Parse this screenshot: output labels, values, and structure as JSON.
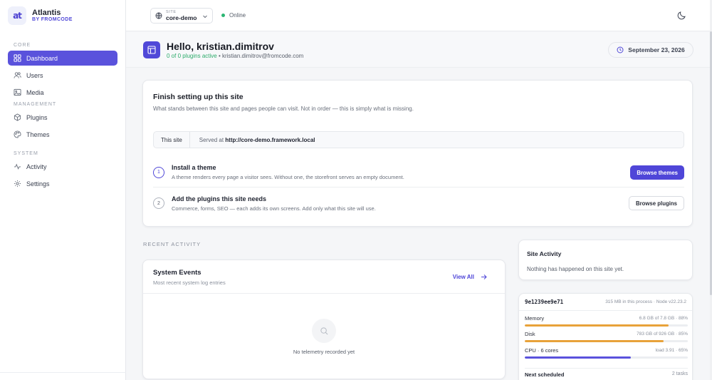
{
  "brand": {
    "name": "Atlantis",
    "sub": "BY FROMCODE",
    "logo_text": "at"
  },
  "sidebar": {
    "sections": [
      {
        "label": "CORE"
      },
      {
        "label": "MANAGEMENT"
      },
      {
        "label": "SYSTEM"
      }
    ],
    "items": [
      {
        "label": "Dashboard",
        "icon": "dashboard-icon",
        "active": true
      },
      {
        "label": "Users",
        "icon": "users-icon"
      },
      {
        "label": "Media",
        "icon": "image-icon"
      },
      {
        "label": "Plugins",
        "icon": "cube-icon"
      },
      {
        "label": "Themes",
        "icon": "palette-icon"
      },
      {
        "label": "Activity",
        "icon": "activity-icon"
      },
      {
        "label": "Settings",
        "icon": "gear-icon"
      }
    ]
  },
  "topbar": {
    "site_label": "SITE",
    "site_value": "core-demo",
    "status": "Online"
  },
  "header": {
    "greeting": "Hello, kristian.dimitrov",
    "plugins_active": "0 of 0 plugins active",
    "email": "kristian.dimitrov@fromcode.com",
    "date": "September 23, 2026"
  },
  "setup": {
    "title": "Finish setting up this site",
    "description": "What stands between this site and pages people can visit. Not in order — this is simply what is missing.",
    "site_label": "This site",
    "served_prefix": "Served at ",
    "served_url": "http://core-demo.framework.local",
    "steps": [
      {
        "num": "1",
        "title": "Install a theme",
        "text": "A theme renders every page a visitor sees. Without one, the storefront serves an empty document.",
        "button": "Browse themes"
      },
      {
        "num": "2",
        "title": "Add the plugins this site needs",
        "text": "Commerce, forms, SEO — each adds its own screens. Add only what this site will use.",
        "button": "Browse plugins"
      }
    ]
  },
  "recent": {
    "label": "RECENT ACTIVITY",
    "events_title": "System Events",
    "events_sub": "Most recent system log entries",
    "view_all": "View All",
    "empty": "No telemetry recorded yet"
  },
  "site_activity": {
    "title": "Site Activity",
    "text": "Nothing has happened on this site yet."
  },
  "stats": {
    "hash": "9e1239ee9e71",
    "meta": "315 MB in this process · Node v22.23.2",
    "rows": [
      {
        "name": "Memory",
        "value": "6.8 GB of 7.8 GB · 88%",
        "pct": 88,
        "color": "#e8a23a"
      },
      {
        "name": "Disk",
        "value": "783 GB of 926 GB · 85%",
        "pct": 85,
        "color": "#e8a23a"
      },
      {
        "name": "CPU · 6 cores",
        "value": "load 3.91 · 65%",
        "pct": 65,
        "color": "#5a52dc"
      }
    ],
    "next_label": "Next scheduled",
    "next_value": "2 tasks"
  }
}
